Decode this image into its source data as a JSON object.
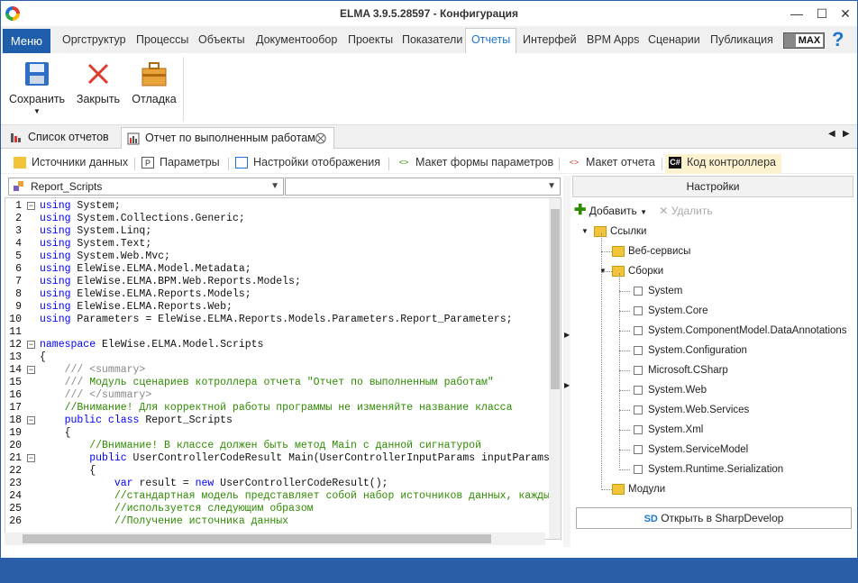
{
  "window": {
    "title": "ELMA 3.9.5.28597 - Конфигурация"
  },
  "menu": {
    "button": "Меню",
    "tabs": [
      "Оргструктур",
      "Процессы",
      "Объекты",
      "Документообор",
      "Проекты",
      "Показатели",
      "Отчеты",
      "Интерфей",
      "BPM Apps",
      "Сценарии",
      "Публикация"
    ],
    "active": "Отчеты",
    "badge": "MAX",
    "help": "?"
  },
  "ribbon": {
    "save": "Сохранить",
    "close": "Закрыть",
    "debug": "Отладка"
  },
  "doc_tabs": [
    "Список отчетов",
    "Отчет по выполненным работам"
  ],
  "sub_tabs": [
    "Источники данных",
    "Параметры",
    "Настройки отображения",
    "Макет формы параметров",
    "Макет отчета",
    "Код контроллера"
  ],
  "editor": {
    "class_combo": "Report_Scripts",
    "member_combo": ""
  },
  "code_lines": [
    {
      "n": "1",
      "t": [
        [
          "kw",
          "using"
        ],
        [
          "tp",
          " System;"
        ]
      ]
    },
    {
      "n": "2",
      "t": [
        [
          "kw",
          "using"
        ],
        [
          "tp",
          " System.Collections.Generic;"
        ]
      ]
    },
    {
      "n": "3",
      "t": [
        [
          "kw",
          "using"
        ],
        [
          "tp",
          " System.Linq;"
        ]
      ]
    },
    {
      "n": "4",
      "t": [
        [
          "kw",
          "using"
        ],
        [
          "tp",
          " System.Text;"
        ]
      ]
    },
    {
      "n": "5",
      "t": [
        [
          "kw",
          "using"
        ],
        [
          "tp",
          " System.Web.Mvc;"
        ]
      ]
    },
    {
      "n": "6",
      "t": [
        [
          "kw",
          "using"
        ],
        [
          "tp",
          " EleWise.ELMA.Model.Metadata;"
        ]
      ]
    },
    {
      "n": "7",
      "t": [
        [
          "kw",
          "using"
        ],
        [
          "tp",
          " EleWise.ELMA.BPM.Web.Reports.Models;"
        ]
      ]
    },
    {
      "n": "8",
      "t": [
        [
          "kw",
          "using"
        ],
        [
          "tp",
          " EleWise.ELMA.Reports.Models;"
        ]
      ]
    },
    {
      "n": "9",
      "t": [
        [
          "kw",
          "using"
        ],
        [
          "tp",
          " EleWise.ELMA.Reports.Web;"
        ]
      ]
    },
    {
      "n": "10",
      "t": [
        [
          "kw",
          "using"
        ],
        [
          "tp",
          " Parameters = EleWise.ELMA.Reports.Models.Parameters.Report_Parameters;"
        ]
      ]
    },
    {
      "n": "11",
      "t": []
    },
    {
      "n": "12",
      "t": [
        [
          "kw",
          "namespace"
        ],
        [
          "tp",
          " EleWise.ELMA.Model.Scripts"
        ]
      ]
    },
    {
      "n": "13",
      "t": [
        [
          "tp",
          "{"
        ]
      ]
    },
    {
      "n": "14",
      "t": [
        [
          "gr",
          "    /// <summary>"
        ]
      ]
    },
    {
      "n": "15",
      "t": [
        [
          "gr",
          "    /// "
        ],
        [
          "cm",
          "Модуль сценариев котроллера отчета \"Отчет по выполненным работам\""
        ]
      ]
    },
    {
      "n": "16",
      "t": [
        [
          "gr",
          "    /// </summary>"
        ]
      ]
    },
    {
      "n": "17",
      "t": [
        [
          "cm",
          "    //Внимание! Для корректной работы программы не изменяйте название класса"
        ]
      ]
    },
    {
      "n": "18",
      "t": [
        [
          "tp",
          "    "
        ],
        [
          "kw",
          "public class"
        ],
        [
          "tp",
          " Report_Scripts"
        ]
      ]
    },
    {
      "n": "19",
      "t": [
        [
          "tp",
          "    {"
        ]
      ]
    },
    {
      "n": "20",
      "t": [
        [
          "cm",
          "        //Внимание! В классе должен быть метод Main с данной сигнатурой"
        ]
      ]
    },
    {
      "n": "21",
      "t": [
        [
          "tp",
          "        "
        ],
        [
          "kw",
          "public"
        ],
        [
          "tp",
          " UserControllerCodeResult "
        ],
        [
          "tp",
          "Main"
        ],
        [
          "tp",
          "(UserControllerInputParams inputParams)"
        ]
      ]
    },
    {
      "n": "22",
      "t": [
        [
          "tp",
          "        {"
        ]
      ]
    },
    {
      "n": "23",
      "t": [
        [
          "tp",
          "            "
        ],
        [
          "kw",
          "var"
        ],
        [
          "tp",
          " result = "
        ],
        [
          "kw",
          "new"
        ],
        [
          "tp",
          " UserControllerCodeResult();"
        ]
      ]
    },
    {
      "n": "24",
      "t": [
        [
          "cm",
          "            //стандартная модель представляет собой набор источников данных, каждый из"
        ]
      ]
    },
    {
      "n": "25",
      "t": [
        [
          "cm",
          "            //используется следующим образом"
        ]
      ]
    },
    {
      "n": "26",
      "t": [
        [
          "cm",
          "            //Получение источника данных"
        ]
      ]
    }
  ],
  "settings": {
    "header": "Настройки",
    "add": "Добавить",
    "remove": "Удалить",
    "tree": {
      "links": "Ссылки",
      "web": "Веб-сервисы",
      "assemblies": "Сборки",
      "items": [
        "System",
        "System.Core",
        "System.ComponentModel.DataAnnotations",
        "System.Configuration",
        "Microsoft.CSharp",
        "System.Web",
        "System.Web.Services",
        "System.Xml",
        "System.ServiceModel",
        "System.Runtime.Serialization"
      ],
      "modules": "Модули"
    },
    "open_button": "Открыть в SharpDevelop"
  },
  "colors": {
    "accent": "#1e74d0",
    "keyword": "#0000ff",
    "comment": "#2e8b00",
    "frame": "#2b5ea8"
  }
}
